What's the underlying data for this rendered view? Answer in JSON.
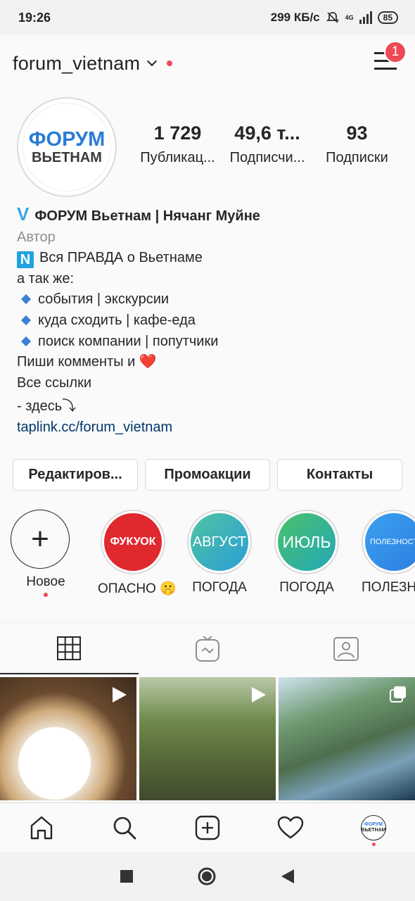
{
  "status_bar": {
    "time": "19:26",
    "speed": "299 КБ/с",
    "network": "4G",
    "battery": "85"
  },
  "header": {
    "username": "forum_vietnam",
    "notification_count": "1"
  },
  "profile": {
    "avatar": {
      "line1": "ФОРУМ",
      "line2": "ВЬЕТНАМ"
    },
    "stats": [
      {
        "number": "1 729",
        "label": "Публикац..."
      },
      {
        "number": "49,6 т...",
        "label": "Подписчи..."
      },
      {
        "number": "93",
        "label": "Подписки"
      }
    ],
    "bio": {
      "v_badge": "V",
      "name": "ФОРУМ Вьетнам | Нячанг Муйне",
      "category": "Автор",
      "n_badge": "N",
      "line1": "Вся ПРАВДА о Вьетнаме",
      "line2": "а так же:",
      "bullets": [
        "события | экскурсии",
        "куда сходить | кафе-еда",
        "поиск компании | попутчики"
      ],
      "line3": "Пиши комменты и ❤️",
      "line4": "Все ссылки",
      "line5": "- здесь⤵",
      "link": "taplink.cc/forum_vietnam"
    }
  },
  "buttons": {
    "edit": "Редактиров...",
    "promo": "Промоакции",
    "contacts": "Контакты"
  },
  "highlights": [
    {
      "label": "Новое",
      "cover_text": "+"
    },
    {
      "label": "ОПАСНО 🤫",
      "cover_text": "ФУКУОК",
      "color": "#e0282f"
    },
    {
      "label": "ПОГОДА",
      "cover_text": "АВГУСТ",
      "color": "#3ab7a4"
    },
    {
      "label": "ПОГОДА",
      "cover_text": "ИЮЛЬ",
      "color": "#2fb58f"
    },
    {
      "label": "ПОЛЕЗН",
      "cover_text": "ПОЛЕЗНОСТ",
      "color": "#2e97e8"
    }
  ],
  "tabs": [
    "grid-icon",
    "igtv-icon",
    "tagged-icon"
  ],
  "bottom_nav": [
    "home-icon",
    "search-icon",
    "new-post-icon",
    "activity-icon",
    "profile-avatar"
  ],
  "profile_mini": {
    "line1": "ФОРУМ",
    "line2": "ВЬЕТНАМ"
  }
}
